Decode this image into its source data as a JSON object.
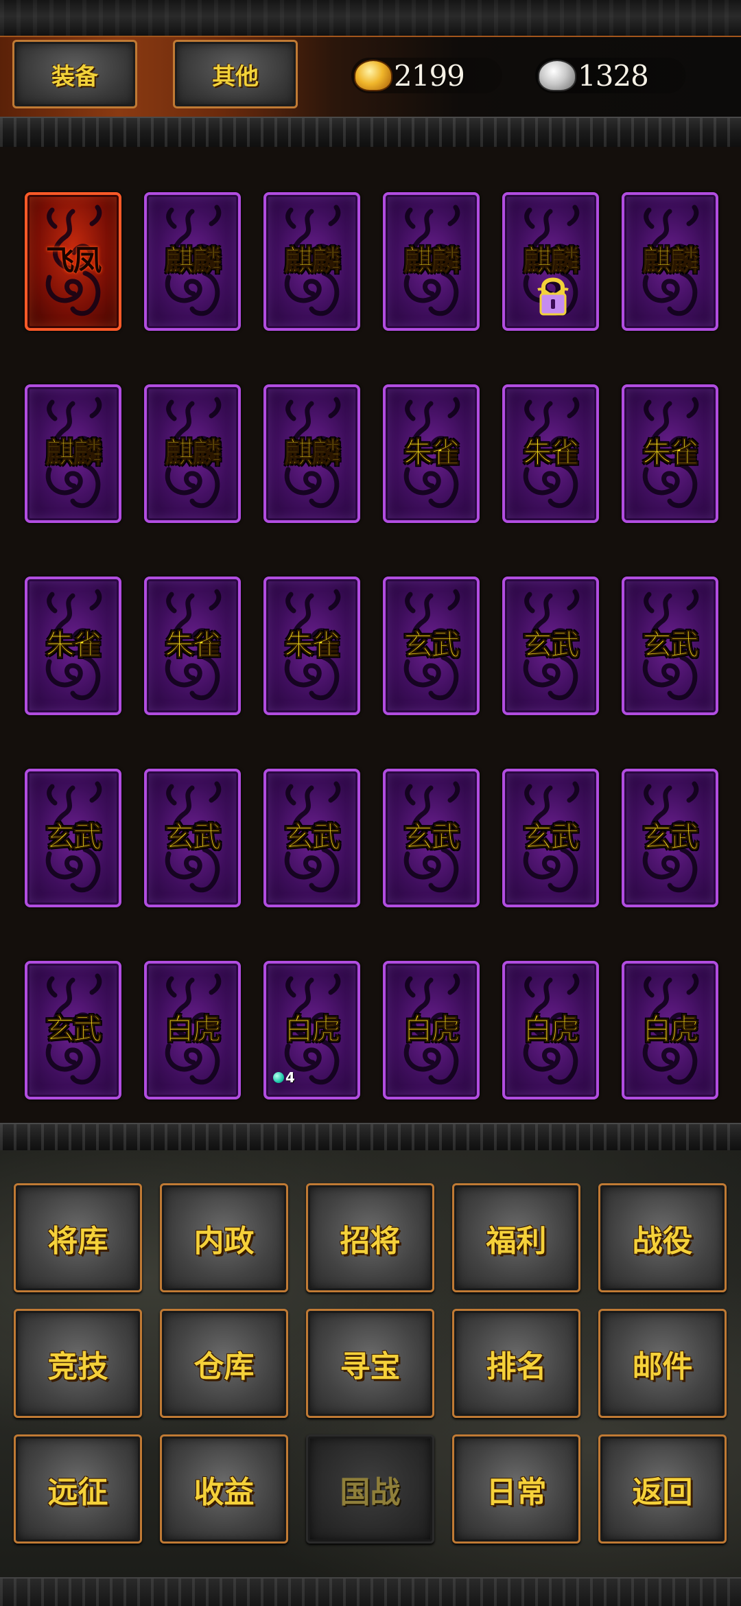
{
  "header": {
    "tabs": [
      {
        "label": "装备"
      },
      {
        "label": "其他"
      }
    ],
    "gold": {
      "amount": "2199",
      "icon": "gold-ingot-icon"
    },
    "silver": {
      "amount": "1328",
      "icon": "silver-ingot-icon"
    }
  },
  "cards": [
    {
      "label": "飞凤",
      "style": "red"
    },
    {
      "label": "麒麟",
      "style": "purple"
    },
    {
      "label": "麒麟",
      "style": "purple"
    },
    {
      "label": "麒麟",
      "style": "purple"
    },
    {
      "label": "麒麟",
      "style": "purple",
      "locked": true
    },
    {
      "label": "麒麟",
      "style": "purple"
    },
    {
      "label": "麒麟",
      "style": "purple"
    },
    {
      "label": "麒麟",
      "style": "purple"
    },
    {
      "label": "麒麟",
      "style": "purple"
    },
    {
      "label": "朱雀",
      "style": "purple"
    },
    {
      "label": "朱雀",
      "style": "purple"
    },
    {
      "label": "朱雀",
      "style": "purple"
    },
    {
      "label": "朱雀",
      "style": "purple"
    },
    {
      "label": "朱雀",
      "style": "purple"
    },
    {
      "label": "朱雀",
      "style": "purple"
    },
    {
      "label": "玄武",
      "style": "purple"
    },
    {
      "label": "玄武",
      "style": "purple"
    },
    {
      "label": "玄武",
      "style": "purple"
    },
    {
      "label": "玄武",
      "style": "purple"
    },
    {
      "label": "玄武",
      "style": "purple"
    },
    {
      "label": "玄武",
      "style": "purple"
    },
    {
      "label": "玄武",
      "style": "purple"
    },
    {
      "label": "玄武",
      "style": "purple"
    },
    {
      "label": "玄武",
      "style": "purple"
    },
    {
      "label": "玄武",
      "style": "purple"
    },
    {
      "label": "白虎",
      "style": "purple"
    },
    {
      "label": "白虎",
      "style": "purple",
      "badge": "4"
    },
    {
      "label": "白虎",
      "style": "purple"
    },
    {
      "label": "白虎",
      "style": "purple"
    },
    {
      "label": "白虎",
      "style": "purple"
    }
  ],
  "menu": [
    {
      "label": "将库"
    },
    {
      "label": "内政"
    },
    {
      "label": "招将"
    },
    {
      "label": "福利"
    },
    {
      "label": "战役"
    },
    {
      "label": "竞技"
    },
    {
      "label": "仓库"
    },
    {
      "label": "寻宝"
    },
    {
      "label": "排名"
    },
    {
      "label": "邮件"
    },
    {
      "label": "远征"
    },
    {
      "label": "收益"
    },
    {
      "label": "国战",
      "disabled": true
    },
    {
      "label": "日常"
    },
    {
      "label": "返回"
    }
  ],
  "colors": {
    "accent_gold": "#f5d13a",
    "card_purple_border": "#b14de0",
    "card_red_border": "#ff5a28",
    "button_border": "#c07a34"
  }
}
